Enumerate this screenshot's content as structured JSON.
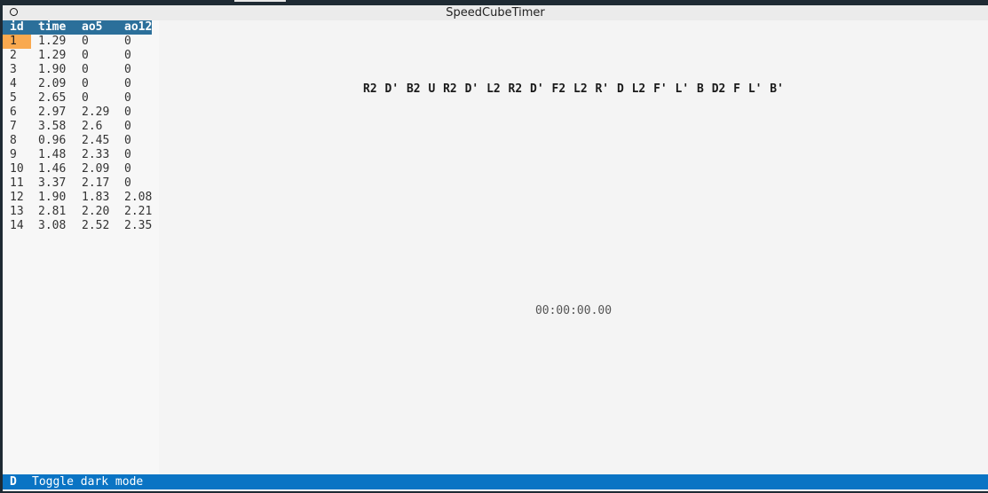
{
  "window": {
    "title": "SpeedCubeTimer"
  },
  "table": {
    "columns": [
      "id",
      "time",
      "ao5",
      "ao12"
    ],
    "selected_row": 0,
    "rows": [
      [
        "1",
        "1.29",
        "0",
        "0"
      ],
      [
        "2",
        "1.29",
        "0",
        "0"
      ],
      [
        "3",
        "1.90",
        "0",
        "0"
      ],
      [
        "4",
        "2.09",
        "0",
        "0"
      ],
      [
        "5",
        "2.65",
        "0",
        "0"
      ],
      [
        "6",
        "2.97",
        "2.29",
        "0"
      ],
      [
        "7",
        "3.58",
        "2.6",
        "0"
      ],
      [
        "8",
        "0.96",
        "2.45",
        "0"
      ],
      [
        "9",
        "1.48",
        "2.33",
        "0"
      ],
      [
        "10",
        "1.46",
        "2.09",
        "0"
      ],
      [
        "11",
        "3.37",
        "2.17",
        "0"
      ],
      [
        "12",
        "1.90",
        "1.83",
        "2.08"
      ],
      [
        "13",
        "2.81",
        "2.20",
        "2.21"
      ],
      [
        "14",
        "3.08",
        "2.52",
        "2.35"
      ]
    ]
  },
  "main": {
    "scramble": "R2 D' B2 U R2 D' L2 R2 D' F2 L2 R' D L2 F' L' B D2 F L' B'",
    "timer": "00:00:00.00"
  },
  "footer": {
    "key": "D",
    "label": "Toggle dark mode"
  },
  "colors": {
    "header_bg": "#2b6f9a",
    "selected_bg": "#f9a94f",
    "footer_bg": "#0a74c4"
  },
  "icons": {
    "window_button": "circle-icon"
  }
}
